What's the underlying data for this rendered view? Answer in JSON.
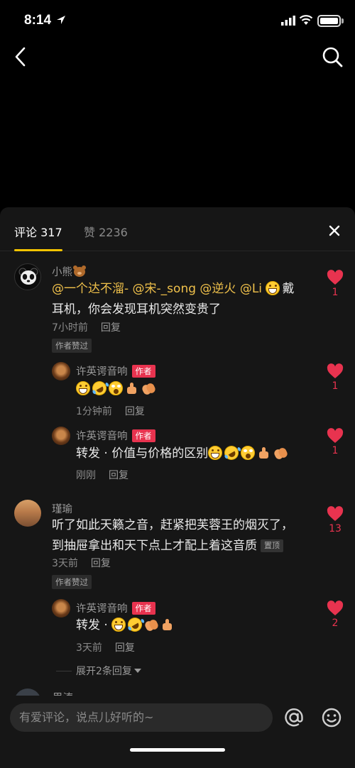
{
  "status_bar": {
    "time": "8:14"
  },
  "tabs": {
    "comments_label": "评论 317",
    "likes_label": "赞 2236"
  },
  "comments": [
    {
      "username": "小熊",
      "mentions": [
        "@一个达不溜-",
        "@宋-_song",
        "@逆火",
        "@Li"
      ],
      "text_line1_suffix": "戴",
      "text_line2": "耳机，你会发现耳机突然变贵了",
      "time": "7小时前",
      "reply_label": "回复",
      "badge": "作者赞过",
      "likes": "1",
      "replies": [
        {
          "username": "许英谔音响",
          "tag": "作者",
          "text": "",
          "time": "1分钟前",
          "reply_label": "回复",
          "likes": "1"
        },
        {
          "username": "许英谔音响",
          "tag": "作者",
          "text": "转发 · 价值与价格的区别",
          "time": "刚刚",
          "reply_label": "回复",
          "likes": "1"
        }
      ]
    },
    {
      "username": "瑾瑜",
      "text_line1": "听了如此天籁之音，赶紧把芙蓉王的烟灭了，",
      "text_line2": "到抽屉拿出和天下点上才配上着这音质",
      "pin": "置顶",
      "time": "3天前",
      "reply_label": "回复",
      "badge": "作者赞过",
      "likes": "13",
      "replies": [
        {
          "username": "许英谔音响",
          "tag": "作者",
          "text": "转发 · ",
          "time": "3天前",
          "reply_label": "回复",
          "likes": "2"
        }
      ]
    }
  ],
  "expand_label": "展开2条回复",
  "peek_username": "思涛",
  "input": {
    "placeholder": "有爱评论，说点儿好听的~"
  },
  "colors": {
    "accent": "#f5c400",
    "like_red": "#e8334f",
    "mention": "#f0c14b",
    "sheet_bg": "#161616"
  },
  "icons": [
    "back-icon",
    "search-icon",
    "close-icon",
    "heart-icon",
    "at-icon",
    "emoji-icon"
  ]
}
